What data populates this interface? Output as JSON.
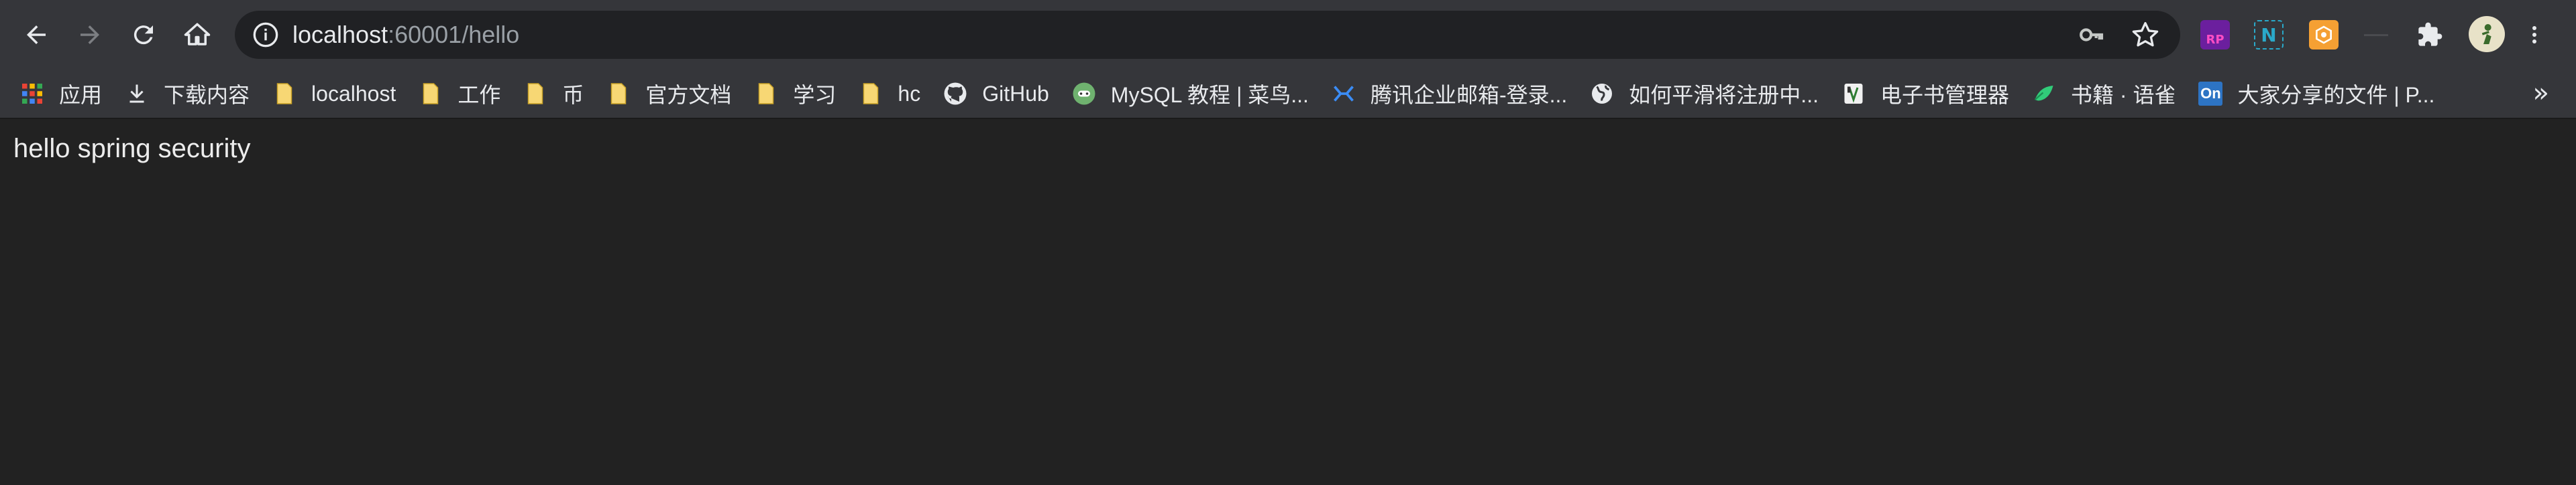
{
  "address_bar": {
    "host": "localhost",
    "port_path": ":60001/hello"
  },
  "bookmarks": [
    {
      "label": "应用",
      "icon": "apps-grid-icon"
    },
    {
      "label": "下载内容",
      "icon": "download-icon"
    },
    {
      "label": "localhost",
      "icon": "folder-icon"
    },
    {
      "label": "工作",
      "icon": "folder-icon"
    },
    {
      "label": "币",
      "icon": "folder-icon"
    },
    {
      "label": "官方文档",
      "icon": "folder-icon"
    },
    {
      "label": "学习",
      "icon": "folder-icon"
    },
    {
      "label": "hc",
      "icon": "folder-icon"
    },
    {
      "label": "GitHub",
      "icon": "github-icon"
    },
    {
      "label": "MySQL 教程 | 菜鸟...",
      "icon": "runoob-icon"
    },
    {
      "label": "腾讯企业邮箱-登录...",
      "icon": "tencent-mail-icon"
    },
    {
      "label": "如何平滑将注册中...",
      "icon": "globe-icon"
    },
    {
      "label": "电子书管理器",
      "icon": "ebook-icon"
    },
    {
      "label": "书籍 · 语雀",
      "icon": "yuque-icon"
    },
    {
      "label": "大家分享的文件 | P...",
      "icon": "on-icon"
    }
  ],
  "extensions": {
    "rp_label": "RP",
    "n_label": "N",
    "on_label": "On",
    "more_label": "»"
  },
  "page": {
    "body_text": "hello spring security"
  },
  "colors": {
    "toolbar_bg": "#35363a",
    "omnibox_bg": "#202124",
    "page_bg": "#222222",
    "folder_yellow": "#f4c542"
  }
}
